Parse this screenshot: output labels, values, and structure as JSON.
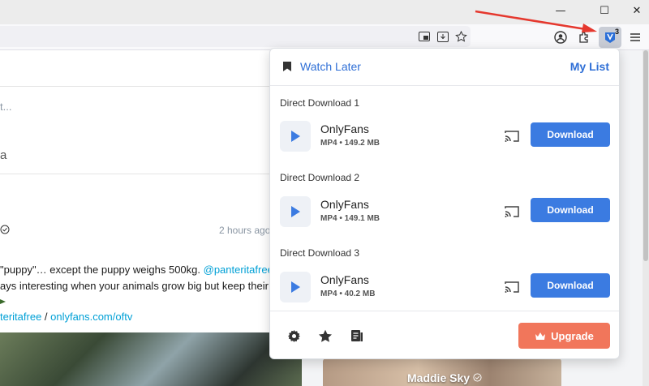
{
  "browser": {
    "window_controls": {
      "minimize": "—",
      "maximize": "☐",
      "close": "✕"
    },
    "extension_badge": "3"
  },
  "background_page": {
    "input_placeholder_fragment": "t...",
    "name_fragment": "a",
    "post_time": "2 hours ago",
    "post_line1_a": "\"puppy\"… except the puppy weighs 500kg. ",
    "post_line1_link": "@panteritafree",
    "post_line2": "ays interesting when your animals grow big but keep their",
    "post_line4_link1": "teritafree",
    "post_line4_sep": " / ",
    "post_line4_link2": "onlyfans.com/oftv",
    "profile_card_name": "Maddie Sky"
  },
  "popup": {
    "watch_later_label": "Watch Later",
    "my_list_label": "My List",
    "downloads": [
      {
        "section": "Direct Download 1",
        "name": "OnlyFans",
        "format": "MP4",
        "size": "149.2 MB",
        "button": "Download"
      },
      {
        "section": "Direct Download 2",
        "name": "OnlyFans",
        "format": "MP4",
        "size": "149.1 MB",
        "button": "Download"
      },
      {
        "section": "Direct Download 3",
        "name": "OnlyFans",
        "format": "MP4",
        "size": "40.2 MB",
        "button": "Download"
      }
    ],
    "meta_separator": "•",
    "upgrade_label": "Upgrade",
    "colors": {
      "accent": "#3b7be1",
      "link": "#2f6fd6",
      "upgrade": "#f1765b"
    }
  }
}
